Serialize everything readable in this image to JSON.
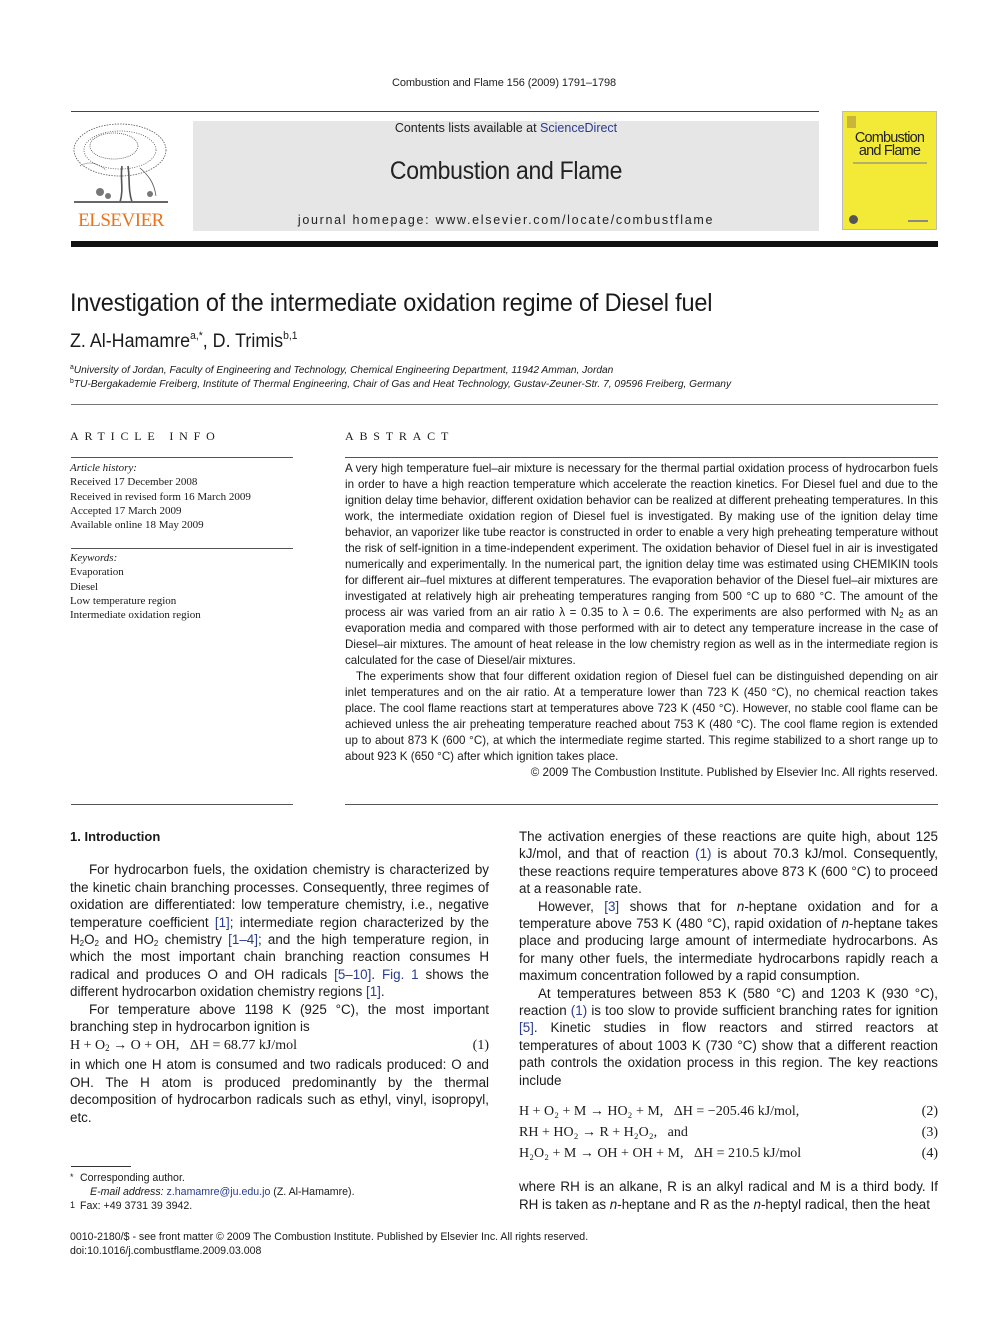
{
  "running_head": "Combustion and Flame 156 (2009) 1791–1798",
  "masthead": {
    "publisher_logo_text": "ELSEVIER",
    "contents_prefix": "Contents lists available at ",
    "contents_link": "ScienceDirect",
    "journal_title": "Combustion and Flame",
    "homepage": "journal homepage: www.elsevier.com/locate/combustflame",
    "cover_title_line1": "Combustion",
    "cover_title_line2": "and Flame",
    "colors": {
      "elsevier_orange": "#e8731c",
      "masthead_gray": "#e6e6e6",
      "cover_yellow": "#f2ea36",
      "link_blue": "#2a3b8f"
    }
  },
  "article": {
    "title": "Investigation of the intermediate oxidation regime of Diesel fuel",
    "authors": [
      {
        "name": "Z. Al-Hamamre",
        "sup": "a,*"
      },
      {
        "name": "D. Trimis",
        "sup": "b,1"
      }
    ],
    "author_separator": ", ",
    "affiliations": [
      {
        "mark": "a",
        "text": "University of Jordan, Faculty of Engineering and Technology, Chemical Engineering Department, 11942 Amman, Jordan"
      },
      {
        "mark": "b",
        "text": "TU-Bergakademie Freiberg, Institute of Thermal Engineering, Chair of Gas and Heat Technology, Gustav-Zeuner-Str. 7, 09596 Freiberg, Germany"
      }
    ]
  },
  "article_info": {
    "heading": "ARTICLE INFO",
    "history_label": "Article history:",
    "history": [
      "Received 17 December 2008",
      "Received in revised form 16 March 2009",
      "Accepted 17 March 2009",
      "Available online 18 May 2009"
    ],
    "keywords_label": "Keywords:",
    "keywords": [
      "Evaporation",
      "Diesel",
      "Low temperature region",
      "Intermediate oxidation region"
    ]
  },
  "abstract": {
    "heading": "ABSTRACT",
    "p1_a": "A very high temperature fuel–air mixture is necessary for the thermal partial oxidation process of hydrocarbon fuels in order to have a high reaction temperature which accelerate the reaction kinetics. For Diesel fuel and due to the ignition delay time behavior, different oxidation behavior can be realized at different preheating temperatures. In this work, the intermediate oxidation region of Diesel fuel is investigated. By making use of the ignition delay time behavior, an vaporizer like tube reactor is constructed in order to enable a very high preheating temperature without the risk of self-ignition in a time-independent experiment. The oxidation behavior of Diesel fuel in air is investigated numerically and experimentally. In the numerical part, the ignition delay time was estimated using CHEMIKIN tools for different air–fuel mixtures at different temperatures. The evaporation behavior of the Diesel fuel–air mixtures are investigated at relatively high air preheating temperatures ranging from 500 °C up to 680 °C. The amount of the process air was varied from an air ratio λ = 0.35 to λ = 0.6. The experiments are also performed with N",
    "p1_sub": "2",
    "p1_b": " as an evaporation media and compared with those performed with air to detect any temperature increase in the case of Diesel–air mixtures. The amount of heat release in the low chemistry region as well as in the intermediate region is calculated for the case of Diesel/air mixtures.",
    "p2": "The experiments show that four different oxidation region of Diesel fuel can be distinguished depending on air inlet temperatures and on the air ratio. At a temperature lower than 723 K (450 °C), no chemical reaction takes place. The cool flame reactions start at temperatures above 723 K (450 °C). However, no stable cool flame can be achieved unless the air preheating temperature reached about 753 K (480 °C). The cool flame region is extended up to about 873 K (600 °C), at which the intermediate regime started. This regime stabilized to a short range up to about 923 K (650 °C) after which ignition takes place.",
    "copyright": "© 2009 The Combustion Institute. Published by Elsevier Inc. All rights reserved."
  },
  "body": {
    "section_heading": "1. Introduction",
    "left": {
      "p1_parts": [
        "For hydrocarbon fuels, the oxidation chemistry is characterized by the kinetic chain branching processes. Consequently, three regimes of oxidation are differentiated: low temperature chemistry, i.e., negative temperature coefficient ",
        "[1]",
        "; intermediate region characterized by the H",
        "2",
        "O",
        "2",
        " and HO",
        "2",
        " chemistry ",
        "[1–4]",
        "; and the high temperature region, in which the most important chain branching reaction consumes H radical and produces O and OH radicals ",
        "[5–10]",
        ". ",
        "Fig. 1",
        " shows the different hydrocarbon oxidation chemistry regions ",
        "[1]",
        "."
      ],
      "p2": "For temperature above 1198 K (925 °C), the most important branching step in hydrocarbon ignition is",
      "eq1": {
        "lhs": "H + O",
        "sub": "2",
        "rhs": " → O + OH,   ΔH = 68.77 kJ/mol",
        "number": "(1)"
      },
      "p3": "in which one H atom is consumed and two radicals produced: O and OH. The H atom is produced predominantly by the thermal decomposition of hydrocarbon radicals such as ethyl, vinyl, isopropyl, etc."
    },
    "right": {
      "p1_a": "The activation energies of these reactions are quite high, about 125 kJ/mol, and that of reaction ",
      "p1_ref": "(1)",
      "p1_b": " is about 70.3 kJ/mol. Consequently, these reactions require temperatures above 873 K (600 °C) to proceed at a reasonable rate.",
      "p2_a": "However, ",
      "p2_ref": "[3]",
      "p2_b": " shows that for ",
      "p2_n1": "n",
      "p2_c": "-heptane oxidation and for a temperature above 753 K (480 °C), rapid oxidation of ",
      "p2_n2": "n",
      "p2_d": "-heptane takes place and producing large amount of intermediate hydrocarbons. As for many other fuels, the intermediate hydrocarbons rapidly reach a maximum concentration followed by a rapid consumption.",
      "p3_a": "At temperatures between 853 K (580 °C) and 1203 K (930 °C), reaction ",
      "p3_ref1": "(1)",
      "p3_b": " is too slow to provide sufficient branching rates for ignition ",
      "p3_ref2": "[5]",
      "p3_c": ". Kinetic studies in flow reactors and stirred reactors at temperatures of about 1003 K (730 °C) show that a different reaction path controls the oxidation process in this region. The key reactions include",
      "equations": [
        {
          "text": "H + O₂ + M → HO₂ + M,   ΔH = −205.46 kJ/mol,",
          "number": "(2)"
        },
        {
          "text": "RH + HO₂ → R + H₂O₂,   and",
          "number": "(3)"
        },
        {
          "text": "H₂O₂ + M → OH + OH + M,   ΔH = 210.5 kJ/mol",
          "number": "(4)"
        }
      ],
      "p4_a": "where RH is an alkane, R is an alkyl radical and M is a third body. If RH is taken as ",
      "p4_n1": "n",
      "p4_b": "-heptane and R as the ",
      "p4_n2": "n",
      "p4_c": "-heptyl radical, then the heat"
    }
  },
  "footnotes": {
    "star_mark": "*",
    "corresponding": "Corresponding author.",
    "email_label": "E-mail address: ",
    "email": "z.hamamre@ju.edu.jo",
    "email_owner": " (Z. Al-Hamamre).",
    "one_mark": "1",
    "fax": "Fax: +49 3731 39 3942."
  },
  "front_matter": {
    "issn_line": "0010-2180/$ - see front matter © 2009 The Combustion Institute. Published by Elsevier Inc. All rights reserved.",
    "doi": "doi:10.1016/j.combustflame.2009.03.008"
  }
}
